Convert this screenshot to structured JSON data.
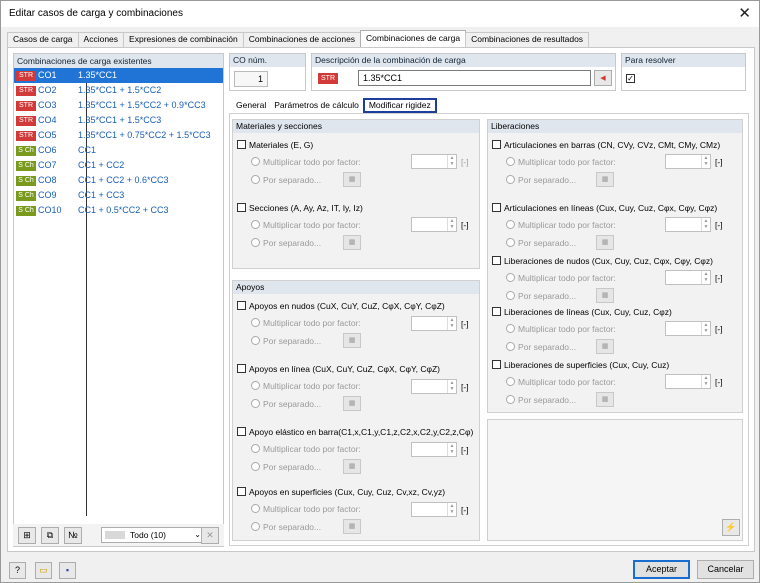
{
  "window": {
    "title": "Editar casos de carga y combinaciones",
    "close": "✕"
  },
  "tabs": [
    "Casos de carga",
    "Acciones",
    "Expresiones de combinación",
    "Combinaciones de acciones",
    "Combinaciones de carga",
    "Combinaciones de resultados"
  ],
  "list": {
    "header": "Combinaciones de carga existentes",
    "rows": [
      {
        "badge": "STR",
        "id": "CO1",
        "expr": "1.35*CC1"
      },
      {
        "badge": "STR",
        "id": "CO2",
        "expr": "1.35*CC1 + 1.5*CC2"
      },
      {
        "badge": "STR",
        "id": "CO3",
        "expr": "1.35*CC1 + 1.5*CC2 + 0.9*CC3"
      },
      {
        "badge": "STR",
        "id": "CO4",
        "expr": "1.35*CC1 + 1.5*CC3"
      },
      {
        "badge": "STR",
        "id": "CO5",
        "expr": "1.35*CC1 + 0.75*CC2 + 1.5*CC3"
      },
      {
        "badge": "S Ch",
        "id": "CO6",
        "expr": "CC1"
      },
      {
        "badge": "S Ch",
        "id": "CO7",
        "expr": "CC1 + CC2"
      },
      {
        "badge": "S Ch",
        "id": "CO8",
        "expr": "CC1 + CC2 + 0.6*CC3"
      },
      {
        "badge": "S Ch",
        "id": "CO9",
        "expr": "CC1 + CC3"
      },
      {
        "badge": "S Ch",
        "id": "CO10",
        "expr": "CC1 + 0.5*CC2 + CC3"
      }
    ],
    "filter": "Todo (10)"
  },
  "co": {
    "label": "CO núm.",
    "value": "1"
  },
  "desc": {
    "label": "Descripción de la combinación de carga",
    "badge": "STR",
    "value": "1.35*CC1"
  },
  "solve": {
    "label": "Para resolver"
  },
  "subtabs": [
    "General",
    "Parámetros de cálculo",
    "Modificar rigidez"
  ],
  "common": {
    "mult": "Multiplicar todo por factor:",
    "sep": "Por separado...",
    "unit": "[-]"
  },
  "mat": {
    "header": "Materiales y secciones",
    "materials": "Materiales (E, G)",
    "sections": "Secciones (A, Ay, Az, IT, Iy, Iz)"
  },
  "sup": {
    "header": "Apoyos",
    "nodes": "Apoyos en nudos (CuX, CuY, CuZ, CφX, CφY, CφZ)",
    "line": "Apoyos en línea (CuX, CuY, CuZ, CφX, CφY, CφZ)",
    "elastic": "Apoyo elástico en barra(C1,x,C1,y,C1,z,C2,x,C2,y,C2,z,Cφ)",
    "surf": "Apoyos en superficies (Cux, Cuy, Cuz, Cv,xz, Cv,yz)"
  },
  "rel": {
    "header": "Liberaciones",
    "bars": "Articulaciones en barras (CN, CVy, CVz, CMt, CMy, CMz)",
    "lines": "Articulaciones en líneas (Cux, Cuy, Cuz, Cφx, Cφy, Cφz)",
    "nodes": "Liberaciones de nudos (Cux, Cuy, Cuz, Cφx, Cφy, Cφz)",
    "lineRel": "Liberaciones de líneas (Cux, Cuy, Cuz, Cφz)",
    "surf": "Liberaciones de superficies (Cux, Cuy, Cuz)"
  },
  "footer": {
    "ok": "Aceptar",
    "cancel": "Cancelar"
  }
}
